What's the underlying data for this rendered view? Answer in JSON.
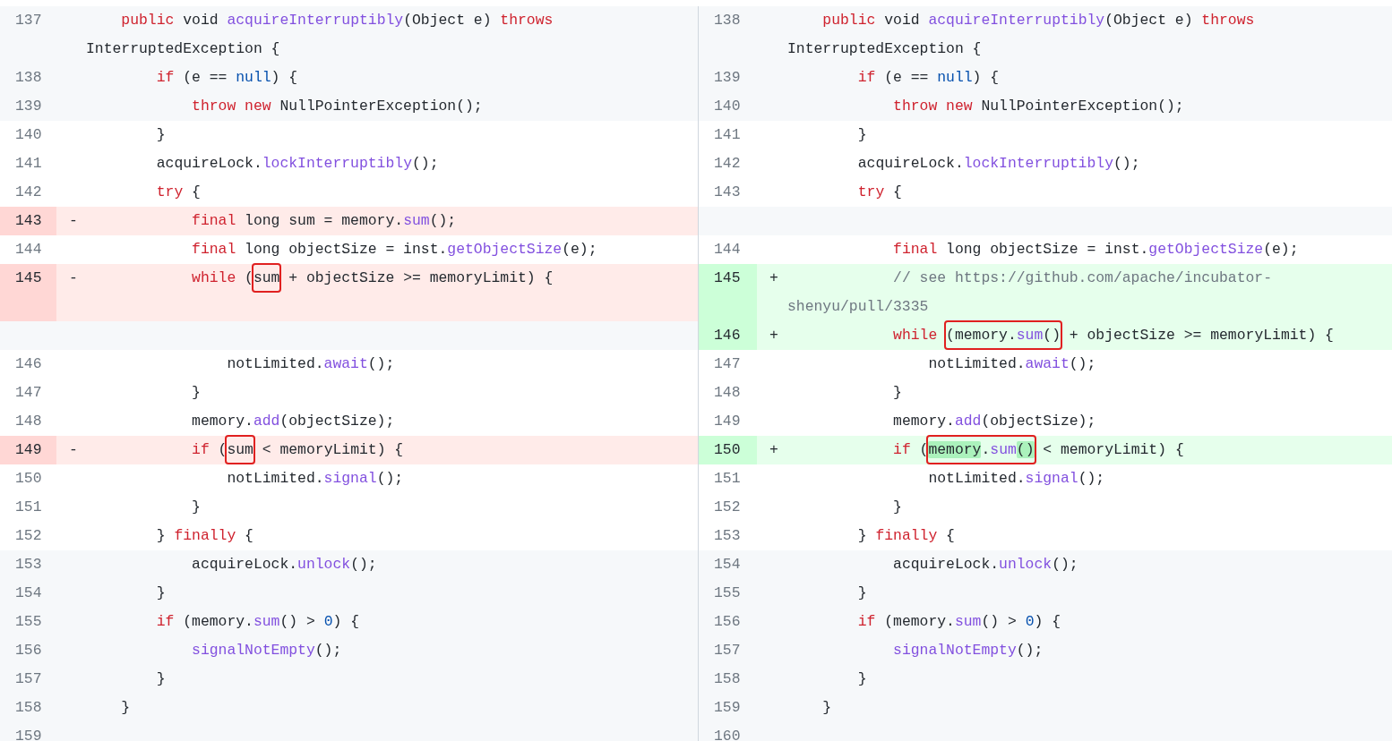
{
  "diff": {
    "rows": [
      {
        "left": {
          "kind": "expanded",
          "num": "137",
          "code": [
            {
              "t": "    public",
              "kind": "keyword"
            },
            {
              "t": " void "
            },
            {
              "t": "acquireInterruptibly",
              "kind": "function"
            },
            {
              "t": "(Object e) "
            },
            {
              "t": "throws",
              "kind": "keyword"
            },
            {
              "t": " InterruptedException {"
            }
          ]
        },
        "right": {
          "kind": "expanded",
          "num": "138",
          "code": [
            {
              "t": "    public",
              "kind": "keyword"
            },
            {
              "t": " void "
            },
            {
              "t": "acquireInterruptibly",
              "kind": "function"
            },
            {
              "t": "(Object e) "
            },
            {
              "t": "throws",
              "kind": "keyword"
            },
            {
              "t": " InterruptedException {"
            }
          ]
        }
      },
      {
        "left": {
          "kind": "expanded",
          "num": "138",
          "code": [
            {
              "t": "        if",
              "kind": "keyword"
            },
            {
              "t": " (e == "
            },
            {
              "t": "null",
              "kind": "literal"
            },
            {
              "t": ") {"
            }
          ]
        },
        "right": {
          "kind": "expanded",
          "num": "139",
          "code": [
            {
              "t": "        if",
              "kind": "keyword"
            },
            {
              "t": " (e == "
            },
            {
              "t": "null",
              "kind": "literal"
            },
            {
              "t": ") {"
            }
          ]
        }
      },
      {
        "left": {
          "kind": "expanded",
          "num": "139",
          "code": [
            {
              "t": "            throw new",
              "kind": "keyword"
            },
            {
              "t": " NullPointerException();"
            }
          ]
        },
        "right": {
          "kind": "expanded",
          "num": "140",
          "code": [
            {
              "t": "            throw new",
              "kind": "keyword"
            },
            {
              "t": " NullPointerException();"
            }
          ]
        }
      },
      {
        "left": {
          "kind": "context",
          "num": "140",
          "code": [
            {
              "t": "        }"
            }
          ]
        },
        "right": {
          "kind": "context",
          "num": "141",
          "code": [
            {
              "t": "        }"
            }
          ]
        }
      },
      {
        "left": {
          "kind": "context",
          "num": "141",
          "code": [
            {
              "t": "        acquireLock."
            },
            {
              "t": "lockInterruptibly",
              "kind": "function"
            },
            {
              "t": "();"
            }
          ]
        },
        "right": {
          "kind": "context",
          "num": "142",
          "code": [
            {
              "t": "        acquireLock."
            },
            {
              "t": "lockInterruptibly",
              "kind": "function"
            },
            {
              "t": "();"
            }
          ]
        }
      },
      {
        "left": {
          "kind": "context",
          "num": "142",
          "code": [
            {
              "t": "        try",
              "kind": "keyword"
            },
            {
              "t": " {"
            }
          ]
        },
        "right": {
          "kind": "context",
          "num": "143",
          "code": [
            {
              "t": "        try",
              "kind": "keyword"
            },
            {
              "t": " {"
            }
          ]
        }
      },
      {
        "left": {
          "kind": "removed",
          "num": "143",
          "sign": "-",
          "code": [
            {
              "t": "            final",
              "kind": "keyword"
            },
            {
              "t": " long sum = memory."
            },
            {
              "t": "sum",
              "kind": "function"
            },
            {
              "t": "();"
            }
          ]
        },
        "right": {
          "kind": "spacer"
        }
      },
      {
        "left": {
          "kind": "context",
          "num": "144",
          "code": [
            {
              "t": "            final",
              "kind": "keyword"
            },
            {
              "t": " long objectSize = inst."
            },
            {
              "t": "getObjectSize",
              "kind": "function"
            },
            {
              "t": "(e);"
            }
          ]
        },
        "right": {
          "kind": "context",
          "num": "144",
          "code": [
            {
              "t": "            final",
              "kind": "keyword"
            },
            {
              "t": " long objectSize = inst."
            },
            {
              "t": "getObjectSize",
              "kind": "function"
            },
            {
              "t": "(e);"
            }
          ]
        }
      },
      {
        "left": {
          "kind": "removed",
          "num": "145",
          "sign": "-",
          "code": [
            {
              "t": "            while",
              "kind": "keyword"
            },
            {
              "t": " ("
            },
            {
              "kind": "box",
              "parts": [
                {
                  "t": "sum"
                }
              ]
            },
            {
              "t": " + objectSize >= memoryLimit) {"
            }
          ]
        },
        "right": {
          "kind": "added",
          "num": "145",
          "sign": "+",
          "code": [
            {
              "t": "            // see https://github.com/apache/incubator-shenyu/pull/3335",
              "kind": "comment"
            }
          ]
        }
      },
      {
        "left": {
          "kind": "spacer"
        },
        "right": {
          "kind": "added",
          "num": "146",
          "sign": "+",
          "code": [
            {
              "t": "            while ",
              "kind": "keyword"
            },
            {
              "kind": "box",
              "parts": [
                {
                  "t": "(memory."
                },
                {
                  "t": "sum",
                  "kind": "function"
                },
                {
                  "t": "()"
                }
              ]
            },
            {
              "t": " + objectSize >= memoryLimit) {"
            }
          ]
        }
      },
      {
        "left": {
          "kind": "context",
          "num": "146",
          "code": [
            {
              "t": "                notLimited."
            },
            {
              "t": "await",
              "kind": "function"
            },
            {
              "t": "();"
            }
          ]
        },
        "right": {
          "kind": "context",
          "num": "147",
          "code": [
            {
              "t": "                notLimited."
            },
            {
              "t": "await",
              "kind": "function"
            },
            {
              "t": "();"
            }
          ]
        }
      },
      {
        "left": {
          "kind": "context",
          "num": "147",
          "code": [
            {
              "t": "            }"
            }
          ]
        },
        "right": {
          "kind": "context",
          "num": "148",
          "code": [
            {
              "t": "            }"
            }
          ]
        }
      },
      {
        "left": {
          "kind": "context",
          "num": "148",
          "code": [
            {
              "t": "            memory."
            },
            {
              "t": "add",
              "kind": "function"
            },
            {
              "t": "(objectSize);"
            }
          ]
        },
        "right": {
          "kind": "context",
          "num": "149",
          "code": [
            {
              "t": "            memory."
            },
            {
              "t": "add",
              "kind": "function"
            },
            {
              "t": "(objectSize);"
            }
          ]
        }
      },
      {
        "left": {
          "kind": "removed",
          "num": "149",
          "sign": "-",
          "code": [
            {
              "t": "            if",
              "kind": "keyword"
            },
            {
              "t": " ("
            },
            {
              "kind": "box",
              "parts": [
                {
                  "t": "sum"
                }
              ]
            },
            {
              "t": " < memoryLimit) {"
            }
          ]
        },
        "right": {
          "kind": "added",
          "num": "150",
          "sign": "+",
          "code": [
            {
              "t": "            if",
              "kind": "keyword"
            },
            {
              "t": " ("
            },
            {
              "kind": "box",
              "parts": [
                {
                  "t": "memory",
                  "emph": true
                },
                {
                  "t": "."
                },
                {
                  "t": "sum",
                  "kind": "function"
                },
                {
                  "t": "()",
                  "emph": true
                }
              ]
            },
            {
              "t": " < memoryLimit) {"
            }
          ]
        }
      },
      {
        "left": {
          "kind": "context",
          "num": "150",
          "code": [
            {
              "t": "                notLimited."
            },
            {
              "t": "signal",
              "kind": "function"
            },
            {
              "t": "();"
            }
          ]
        },
        "right": {
          "kind": "context",
          "num": "151",
          "code": [
            {
              "t": "                notLimited."
            },
            {
              "t": "signal",
              "kind": "function"
            },
            {
              "t": "();"
            }
          ]
        }
      },
      {
        "left": {
          "kind": "context",
          "num": "151",
          "code": [
            {
              "t": "            }"
            }
          ]
        },
        "right": {
          "kind": "context",
          "num": "152",
          "code": [
            {
              "t": "            }"
            }
          ]
        }
      },
      {
        "left": {
          "kind": "context",
          "num": "152",
          "code": [
            {
              "t": "        } "
            },
            {
              "t": "finally",
              "kind": "keyword"
            },
            {
              "t": " {"
            }
          ]
        },
        "right": {
          "kind": "context",
          "num": "153",
          "code": [
            {
              "t": "        } "
            },
            {
              "t": "finally",
              "kind": "keyword"
            },
            {
              "t": " {"
            }
          ]
        }
      },
      {
        "left": {
          "kind": "expanded",
          "num": "153",
          "code": [
            {
              "t": "            acquireLock."
            },
            {
              "t": "unlock",
              "kind": "function"
            },
            {
              "t": "();"
            }
          ]
        },
        "right": {
          "kind": "expanded",
          "num": "154",
          "code": [
            {
              "t": "            acquireLock."
            },
            {
              "t": "unlock",
              "kind": "function"
            },
            {
              "t": "();"
            }
          ]
        }
      },
      {
        "left": {
          "kind": "expanded",
          "num": "154",
          "code": [
            {
              "t": "        }"
            }
          ]
        },
        "right": {
          "kind": "expanded",
          "num": "155",
          "code": [
            {
              "t": "        }"
            }
          ]
        }
      },
      {
        "left": {
          "kind": "expanded",
          "num": "155",
          "code": [
            {
              "t": "        if",
              "kind": "keyword"
            },
            {
              "t": " (memory."
            },
            {
              "t": "sum",
              "kind": "function"
            },
            {
              "t": "() > "
            },
            {
              "t": "0",
              "kind": "literal"
            },
            {
              "t": ") {"
            }
          ]
        },
        "right": {
          "kind": "expanded",
          "num": "156",
          "code": [
            {
              "t": "        if",
              "kind": "keyword"
            },
            {
              "t": " (memory."
            },
            {
              "t": "sum",
              "kind": "function"
            },
            {
              "t": "() > "
            },
            {
              "t": "0",
              "kind": "literal"
            },
            {
              "t": ") {"
            }
          ]
        }
      },
      {
        "left": {
          "kind": "expanded",
          "num": "156",
          "code": [
            {
              "t": "            signalNotEmpty",
              "kind": "function"
            },
            {
              "t": "();"
            }
          ]
        },
        "right": {
          "kind": "expanded",
          "num": "157",
          "code": [
            {
              "t": "            signalNotEmpty",
              "kind": "function"
            },
            {
              "t": "();"
            }
          ]
        }
      },
      {
        "left": {
          "kind": "expanded",
          "num": "157",
          "code": [
            {
              "t": "        }"
            }
          ]
        },
        "right": {
          "kind": "expanded",
          "num": "158",
          "code": [
            {
              "t": "        }"
            }
          ]
        }
      },
      {
        "left": {
          "kind": "expanded",
          "num": "158",
          "code": [
            {
              "t": "    }"
            }
          ]
        },
        "right": {
          "kind": "expanded",
          "num": "159",
          "code": [
            {
              "t": "    }"
            }
          ]
        }
      },
      {
        "left": {
          "kind": "expanded",
          "num": "159"
        },
        "right": {
          "kind": "expanded",
          "num": "160"
        }
      }
    ]
  }
}
